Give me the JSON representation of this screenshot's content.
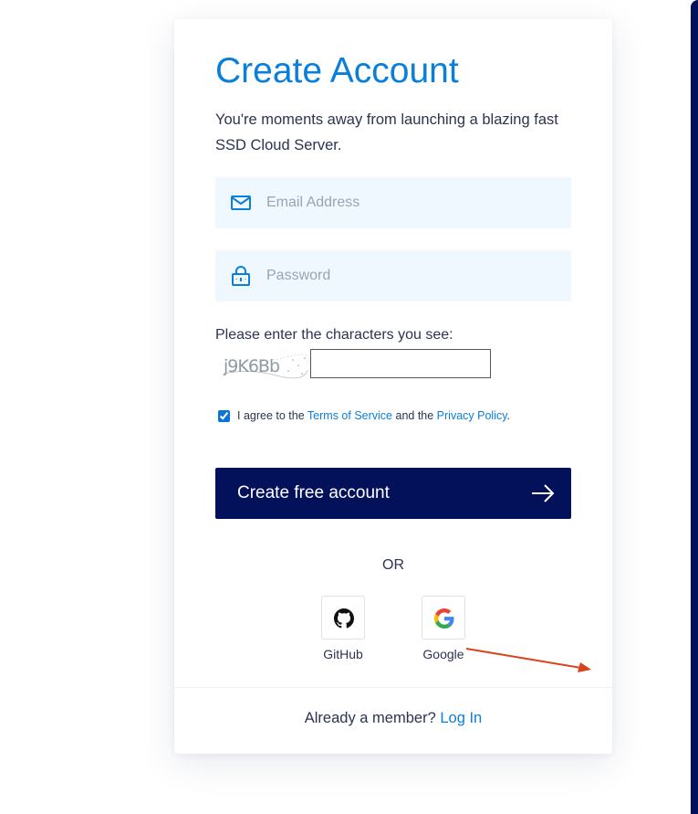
{
  "form": {
    "title": "Create Account",
    "subtitle": "You're moments away from launching a blazing fast SSD Cloud Server.",
    "email": {
      "placeholder": "Email Address",
      "value": "",
      "icon": "envelope-icon"
    },
    "password": {
      "placeholder": "Password",
      "value": "",
      "icon": "lock-icon"
    },
    "captcha": {
      "label": "Please enter the characters you see:",
      "image_text": "j9K6Bb",
      "value": ""
    },
    "terms": {
      "checked": true,
      "prefix": "I agree to the ",
      "tos_link": "Terms of Service",
      "middle": " and the ",
      "privacy_link": "Privacy Policy",
      "suffix": "."
    },
    "submit_label": "Create free account",
    "submit_icon": "arrow-right-icon",
    "or_text": "OR",
    "social": [
      {
        "name": "GitHub",
        "icon": "github-icon"
      },
      {
        "name": "Google",
        "icon": "google-icon"
      }
    ],
    "footer": {
      "prompt": "Already a member? ",
      "login_link": "Log In"
    }
  },
  "colors": {
    "brand_blue": "#0a7fd9",
    "navy": "#03115a",
    "field_bg": "#eff7ff",
    "text": "#2b3450",
    "annotation_red": "#d9421b"
  }
}
